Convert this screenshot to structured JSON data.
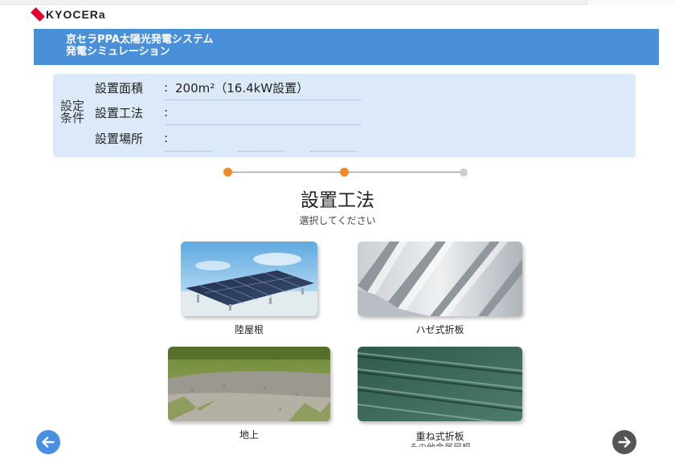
{
  "brand": {
    "logo_text": "KYOCERa",
    "logo_color": "#e4002b"
  },
  "header": {
    "title_line1": "京セラPPA太陽光発電システム",
    "title_line2": "発電シミュレーション",
    "bar_color": "#4a90d9"
  },
  "conditions": {
    "heading": "設定条件",
    "heading_line1": "設定",
    "heading_line2": "条件",
    "rows": [
      {
        "label": "設置面積",
        "value": "200m²（16.4kW設置）"
      },
      {
        "label": "設置工法",
        "value": ""
      },
      {
        "label": "設置場所",
        "value": ""
      }
    ],
    "background": "#dce9f8"
  },
  "stepper": {
    "current_step": 2,
    "total_steps": 3,
    "active_color": "#f08a24",
    "inactive_color": "#cccccc"
  },
  "section": {
    "title": "設置工法",
    "subtitle": "選択してください"
  },
  "options": [
    {
      "label": "陸屋根",
      "image": "flat-roof-solar-photo"
    },
    {
      "label": "ハゼ式折板",
      "image": "seam-folded-metal-roof-photo"
    },
    {
      "label": "地上",
      "image": "ground-gravel-field-photo"
    },
    {
      "label": "重ね式折板",
      "sublabel": "その他金属屋根",
      "image": "lapped-folded-metal-roof-photo"
    }
  ],
  "navigation": {
    "back_icon": "arrow-left-icon",
    "next_icon": "arrow-right-icon",
    "back_color": "#4a90e2",
    "next_color": "#555555"
  }
}
